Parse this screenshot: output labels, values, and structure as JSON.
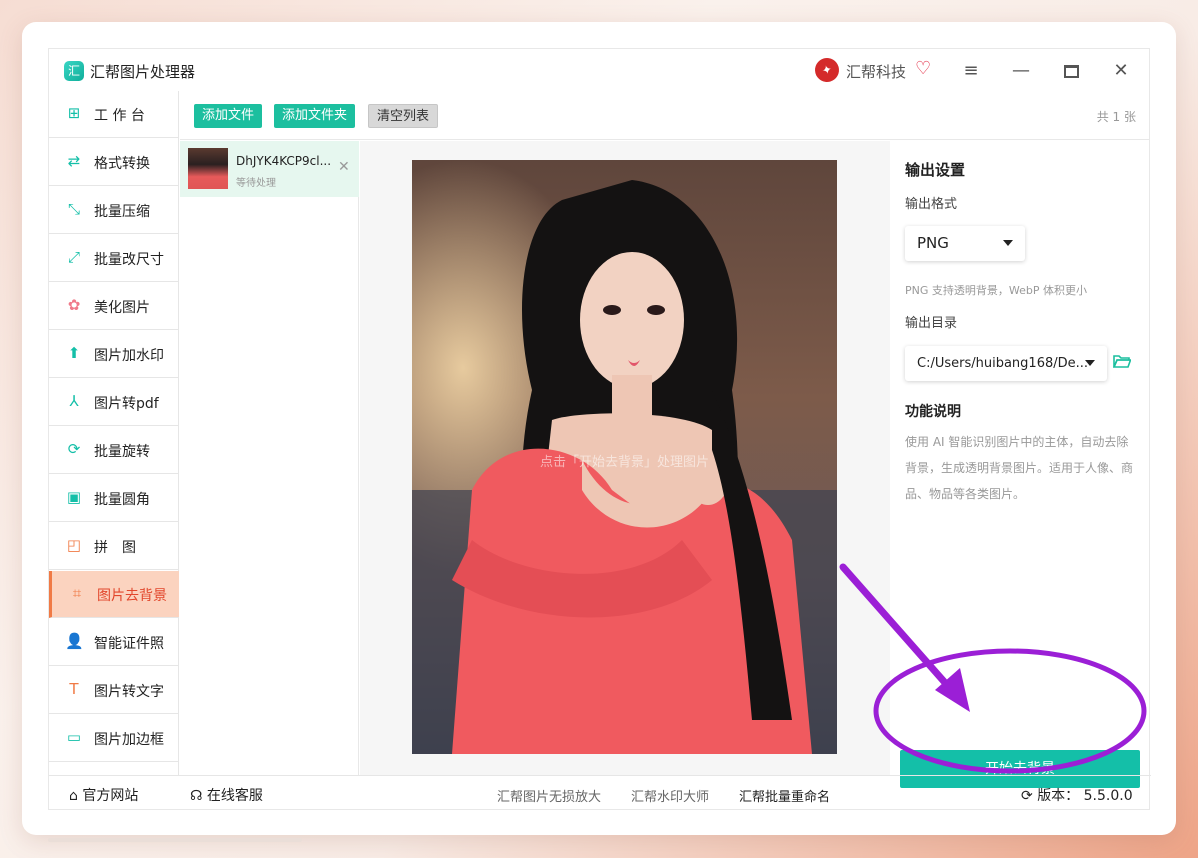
{
  "app": {
    "title": "汇帮图片处理器",
    "brand_name": "汇帮科技",
    "logo_glyph": "汇"
  },
  "window_controls": {
    "menu_icon": "menu-icon",
    "minimize_icon": "minimize-icon",
    "maximize_icon": "maximize-icon",
    "close_icon": "close-icon"
  },
  "sidebar": {
    "items": [
      {
        "label": "工 作 台",
        "icon": "workbench-icon",
        "glyph": "⊞",
        "color": "#14bfa8"
      },
      {
        "label": "格式转换",
        "icon": "format-convert-icon",
        "glyph": "⇄",
        "color": "#14bfa8"
      },
      {
        "label": "批量压缩",
        "icon": "compress-icon",
        "glyph": "⤡",
        "color": "#14bfa8"
      },
      {
        "label": "批量改尺寸",
        "icon": "resize-icon",
        "glyph": "⤢",
        "color": "#14bfa8"
      },
      {
        "label": "美化图片",
        "icon": "beautify-icon",
        "glyph": "✿",
        "color": "#f07a8a"
      },
      {
        "label": "图片加水印",
        "icon": "watermark-icon",
        "glyph": "⬆",
        "color": "#14bfa8"
      },
      {
        "label": "图片转pdf",
        "icon": "pdf-icon",
        "glyph": "⅄",
        "color": "#14bfa8"
      },
      {
        "label": "批量旋转",
        "icon": "rotate-icon",
        "glyph": "⟳",
        "color": "#14bfa8"
      },
      {
        "label": "批量圆角",
        "icon": "round-corner-icon",
        "glyph": "▣",
        "color": "#14bfa8"
      },
      {
        "label": "拼　图",
        "icon": "collage-icon",
        "glyph": "◰",
        "color": "#f07a45"
      },
      {
        "label": "图片去背景",
        "icon": "crop-icon",
        "glyph": "⌗",
        "color": "#f07a45"
      },
      {
        "label": "智能证件照",
        "icon": "id-photo-icon",
        "glyph": "👤",
        "color": "#f07a45"
      },
      {
        "label": "图片转文字",
        "icon": "text-icon",
        "glyph": "T",
        "color": "#f07a45"
      },
      {
        "label": "图片加边框",
        "icon": "border-icon",
        "glyph": "▭",
        "color": "#14bfa8"
      }
    ],
    "active_index": 10
  },
  "toolbar": {
    "add_file": "添加文件",
    "add_folder": "添加文件夹",
    "clear_list": "清空列表",
    "count": "共 1 张"
  },
  "files": [
    {
      "name": "DhJYK4KCP9cl...",
      "status": "等待处理"
    }
  ],
  "preview": {
    "hint": "点击「开始去背景」处理图片"
  },
  "settings": {
    "title": "输出设置",
    "format_label": "输出格式",
    "format_value": "PNG",
    "format_note": "PNG 支持透明背景，WebP 体积更小",
    "dir_label": "输出目录",
    "dir_value": "C:/Users/huibang168/De...",
    "desc_title": "功能说明",
    "desc_text": "使用 AI 智能识别图片中的主体，自动去除背景，生成透明背景图片。适用于人像、商品、物品等各类图片。",
    "start_button": "开始去背景"
  },
  "bottom": {
    "website": "官方网站",
    "service": "在线客服",
    "link1": "汇帮图片无损放大",
    "link2": "汇帮水印大师",
    "link3": "汇帮批量重命名",
    "version": "版本：  5.5.0.0"
  },
  "colors": {
    "accent": "#14bfa8",
    "active_bg": "#fbd3bf",
    "active_text": "#e2472c",
    "annotation": "#9b1fd6"
  }
}
